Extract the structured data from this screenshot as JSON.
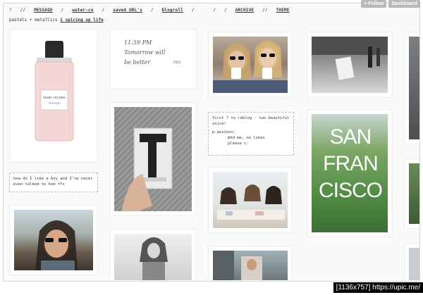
{
  "nav": {
    "home_icon": "question-icon",
    "sep": "//",
    "message": "MESSAGE",
    "water": "water-co",
    "saved": "saved URL's",
    "blogroll": "blogroll",
    "archive": "ARCHIVE",
    "theme": "THEME"
  },
  "tagline": {
    "text": "pastels + metallics",
    "link": "i spicing up life"
  },
  "buttons": {
    "follow": "+ Follow",
    "dashboard": "Dashboard"
  },
  "posts": {
    "handwriting": {
      "line1": "11:59 PM",
      "line2": "Tomorrow will",
      "line3": "be better",
      "sig": "-TKO"
    },
    "perfume": {
      "brand": "MARC JACOBS",
      "name": "PERFUME"
    },
    "text1": "how do I like a boy and I've never even talked to him ffs",
    "text2": {
      "line1": "first ? to reblog - two beautiful",
      "line2": "voice!",
      "line3": "p-avsions:",
      "line4": "mhd me, no likes",
      "line5": "please c:"
    },
    "sf": {
      "l1": "SAN",
      "l2": "FRAN",
      "l3": "CISCO"
    }
  },
  "watermark": "[1136x757] https://upic.me/",
  "colors": {
    "button_bg": "#b8b8b8",
    "frame_border": "#d6d6d6",
    "perfume_pink": "#f2cfcf"
  }
}
